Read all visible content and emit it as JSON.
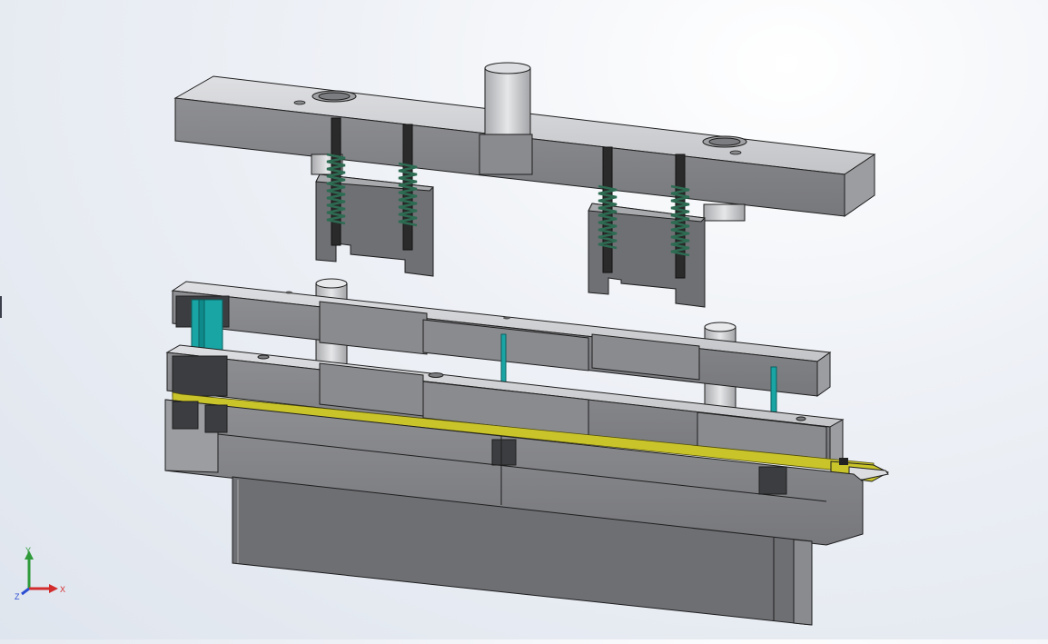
{
  "view": {
    "colors": {
      "steel_top": "#d2d3d6",
      "steel_front": "#8a8b8f",
      "steel_dark": "#6e6f73",
      "steel_shadow": "#5b5c60",
      "edge": "#1e1e1e",
      "spring": "#2d6b52",
      "guide_pin_cyan": "#1aa5a5",
      "strip_yellow": "#c9c42a",
      "block_dark": "#3c3d40"
    }
  },
  "triad": {
    "x_label": "X",
    "y_label": "Y",
    "z_label": "Z",
    "colors": {
      "x": "#d22c2c",
      "y": "#2f9a3a",
      "z": "#2c4fd2"
    }
  }
}
